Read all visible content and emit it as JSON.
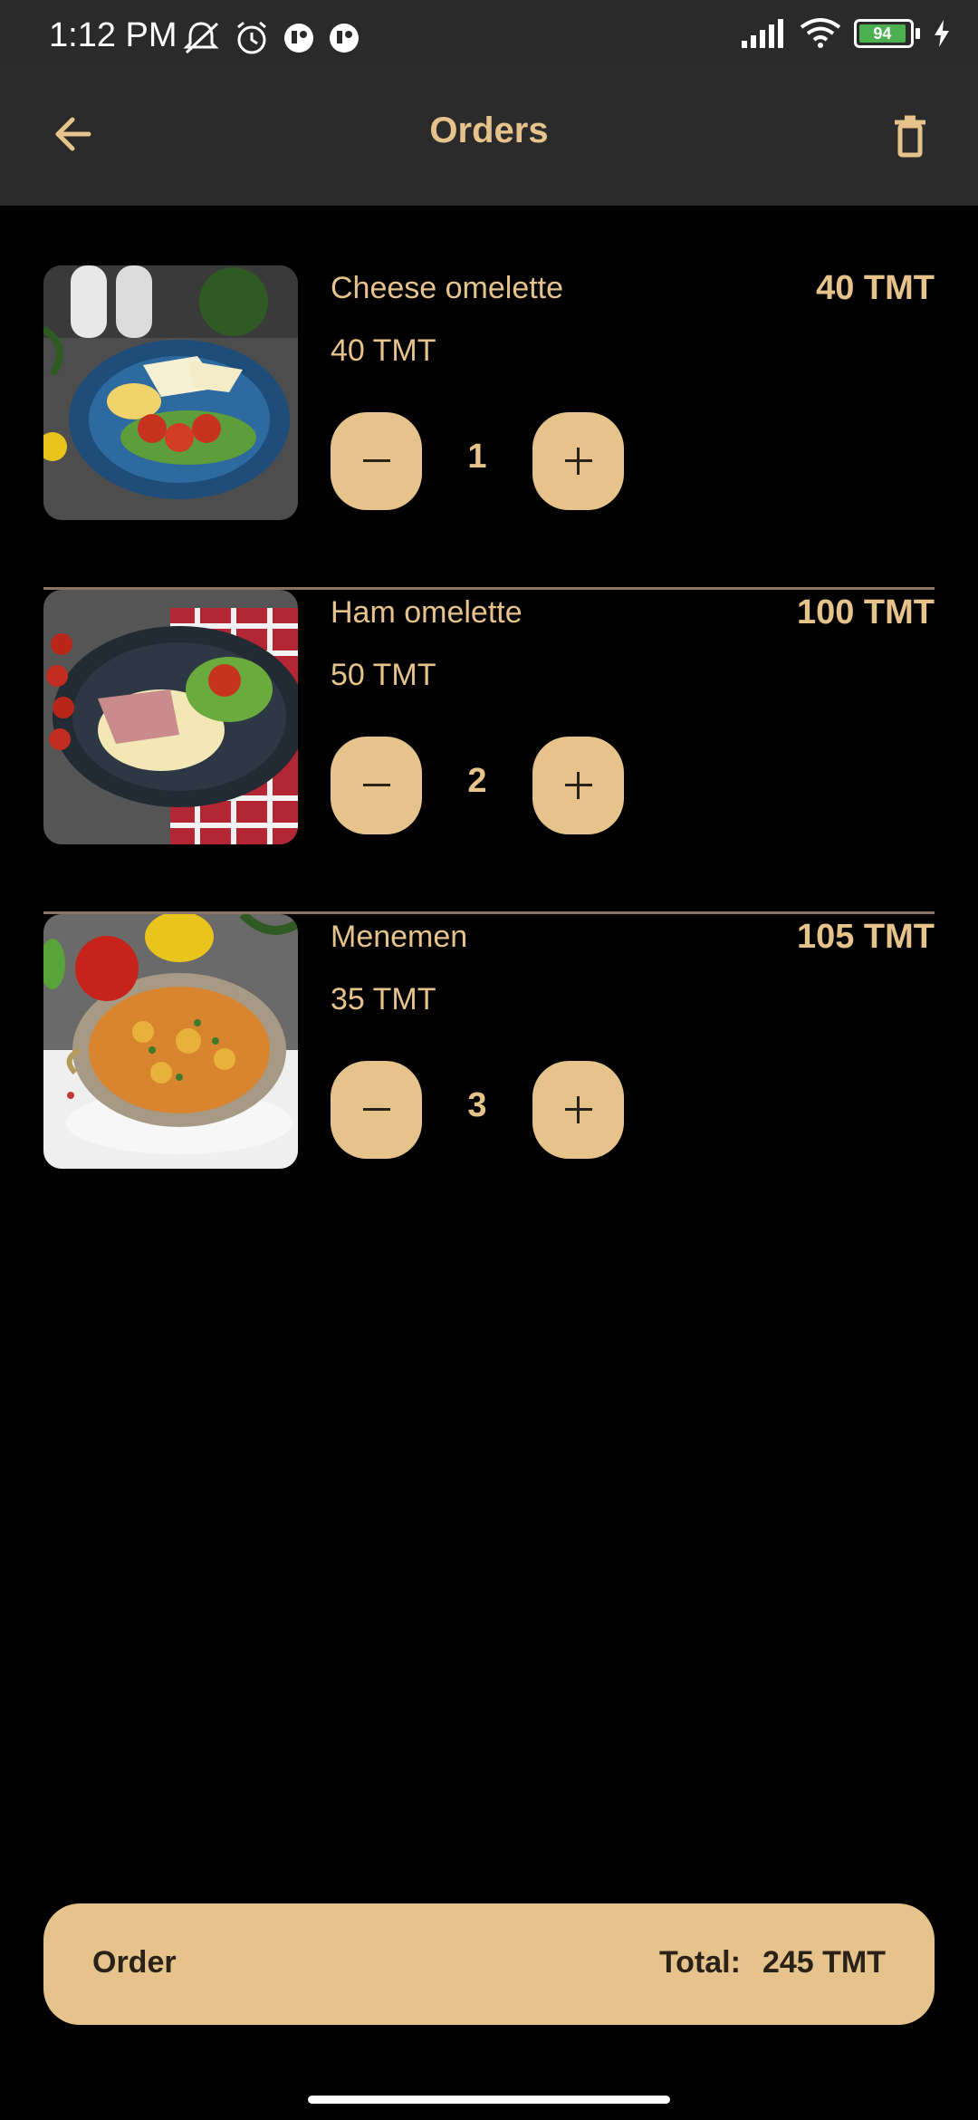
{
  "status_bar": {
    "time": "1:12 PM",
    "battery_level": "94"
  },
  "header": {
    "title": "Orders",
    "back_icon": "arrow-left-icon",
    "delete_icon": "trash-icon"
  },
  "orders": [
    {
      "name": "Cheese omelette",
      "unit_price": "40 TMT",
      "line_total": "40 TMT",
      "quantity": "1"
    },
    {
      "name": "Ham omelette",
      "unit_price": "50 TMT",
      "line_total": "100 TMT",
      "quantity": "2"
    },
    {
      "name": "Menemen",
      "unit_price": "35 TMT",
      "line_total": "105 TMT",
      "quantity": "3"
    }
  ],
  "footer": {
    "order_label": "Order",
    "total_label": "Total:",
    "total_value": "245 TMT"
  },
  "colors": {
    "accent": "#e6c38b",
    "app_bar": "#2b2b2b",
    "background": "#000000"
  }
}
